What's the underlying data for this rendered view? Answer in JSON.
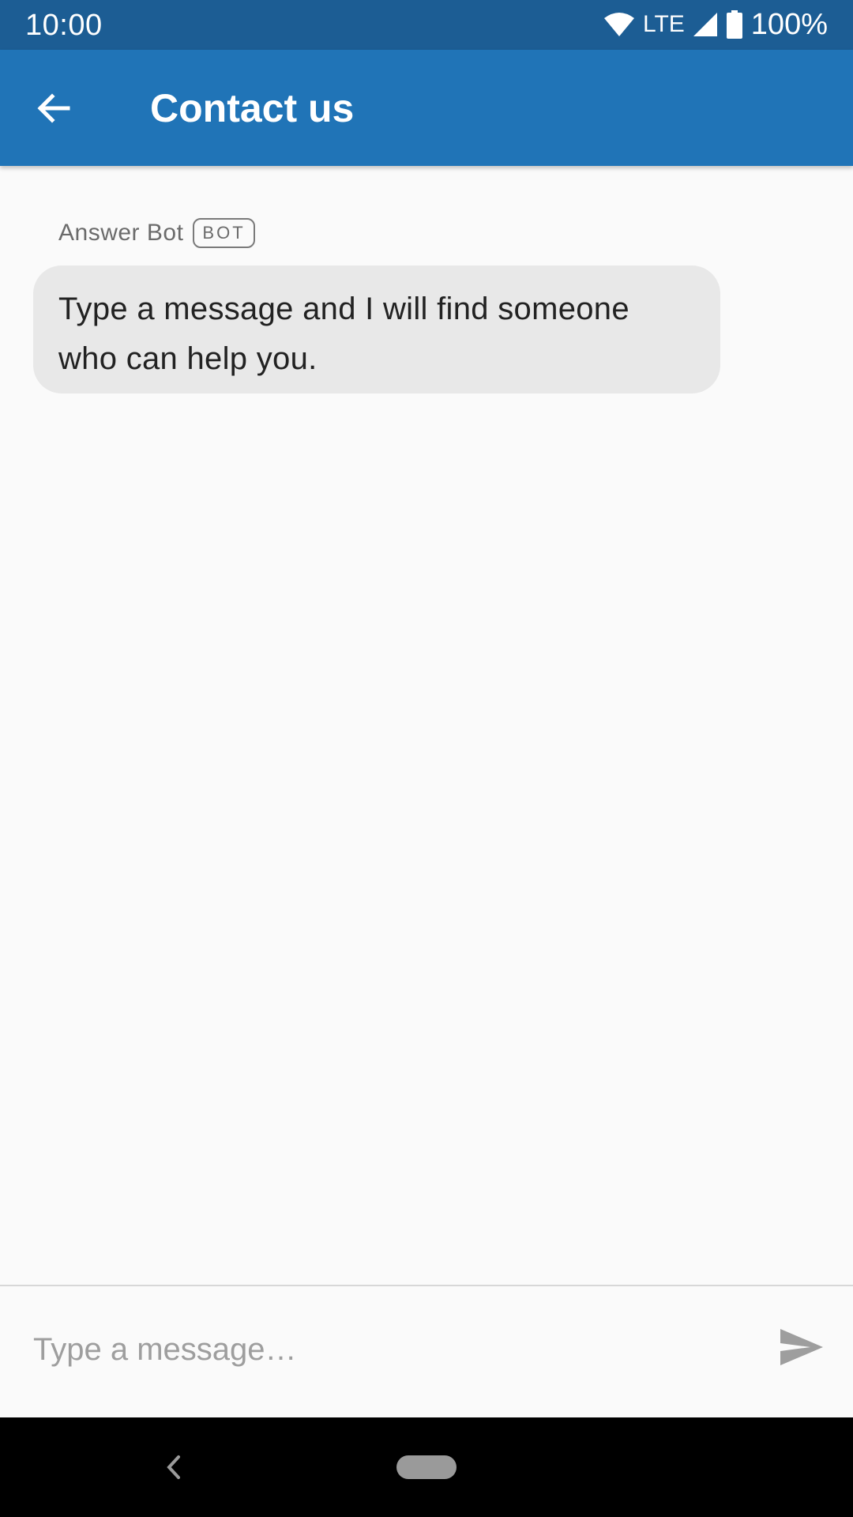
{
  "status_bar": {
    "time": "10:00",
    "network": "LTE",
    "battery": "100%",
    "icons": [
      "wifi-icon",
      "signal-icon",
      "battery-icon"
    ]
  },
  "app_bar": {
    "title": "Contact us",
    "back_icon": "arrow-back-icon"
  },
  "conversation": {
    "sender_name": "Answer Bot",
    "sender_badge": "BOT",
    "message_text": "Type a message and I will find someone who can help you."
  },
  "composer": {
    "placeholder": "Type a message…",
    "value": "",
    "send_icon": "send-icon"
  },
  "nav_bar": {
    "icons": [
      "nav-back-icon",
      "nav-home-pill"
    ]
  },
  "colors": {
    "status_bar": "#1c5d94",
    "app_bar": "#2074b7",
    "background": "#fafafa",
    "bubble": "#e8e8e8",
    "send_icon": "#9e9e9e"
  }
}
